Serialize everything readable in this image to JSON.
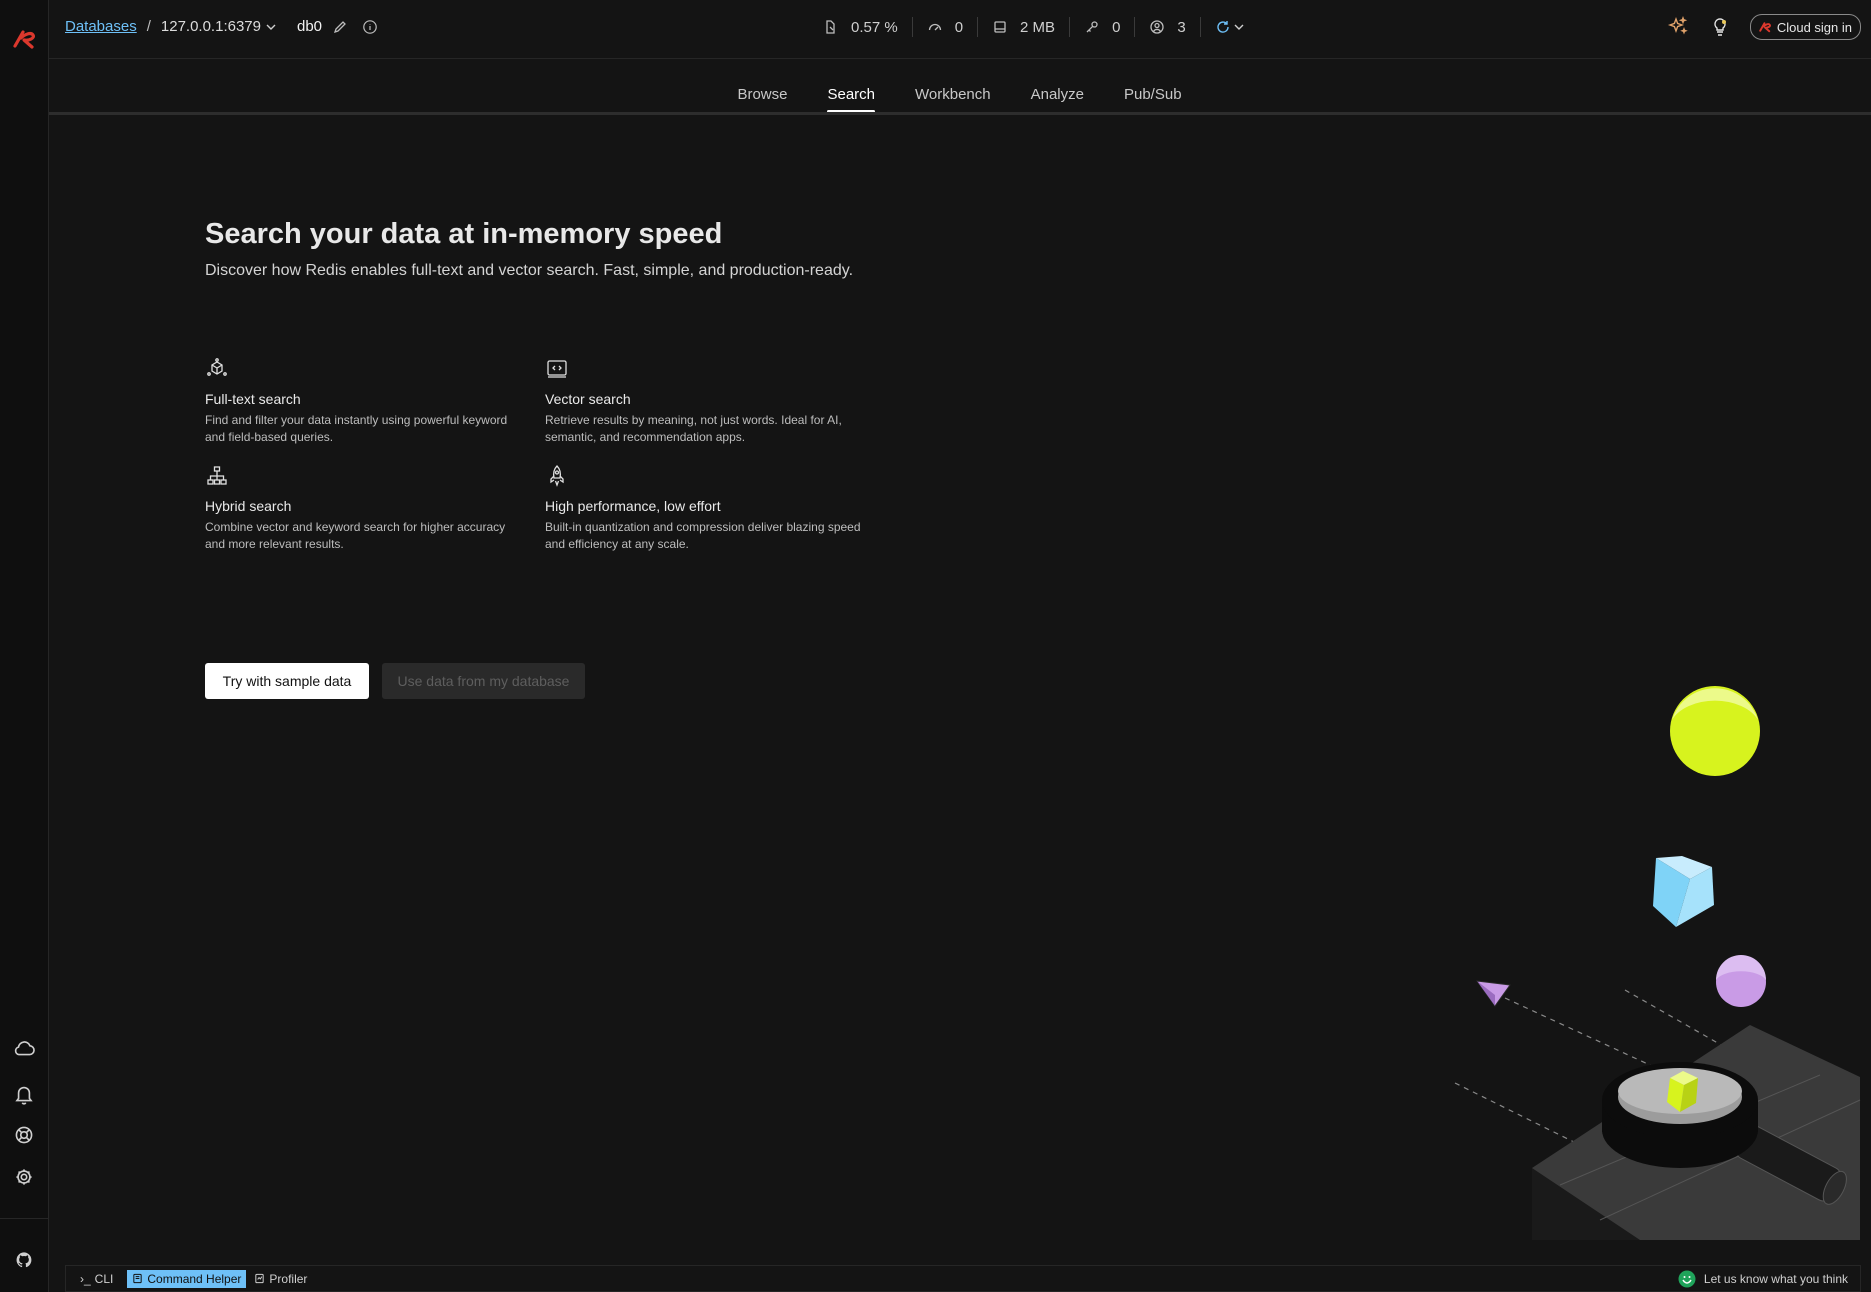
{
  "breadcrumb": {
    "databases": "Databases",
    "separator": "/",
    "host": "127.0.0.1:6379",
    "db": "db0"
  },
  "stats": {
    "cpu": "0.57 %",
    "ops": "0",
    "memory": "2 MB",
    "keys": "0",
    "clients": "3"
  },
  "header": {
    "cloud_signin": "Cloud sign in"
  },
  "tabs": [
    {
      "label": "Browse"
    },
    {
      "label": "Search"
    },
    {
      "label": "Workbench"
    },
    {
      "label": "Analyze"
    },
    {
      "label": "Pub/Sub"
    }
  ],
  "active_tab": "Search",
  "hero": {
    "title": "Search your data at in-memory speed",
    "subtitle": "Discover how Redis enables full-text and vector search. Fast, simple, and production-ready."
  },
  "features": [
    {
      "icon": "cube-network-icon",
      "title": "Full-text search",
      "desc": "Find and filter your data instantly using powerful keyword and field-based queries."
    },
    {
      "icon": "code-window-icon",
      "title": "Vector search",
      "desc": "Retrieve results by meaning, not just words. Ideal for AI, semantic, and recommendation apps."
    },
    {
      "icon": "hierarchy-icon",
      "title": "Hybrid search",
      "desc": "Combine vector and keyword search for higher accuracy and more relevant results."
    },
    {
      "icon": "rocket-icon",
      "title": "High performance, low effort",
      "desc": "Built-in quantization and compression deliver blazing speed and efficiency at any scale."
    }
  ],
  "actions": {
    "try_sample": "Try with sample data",
    "use_my_data": "Use data from my database"
  },
  "bottom_bar": {
    "cli": "CLI",
    "command_helper": "Command Helper",
    "profiler": "Profiler",
    "feedback": "Let us know what you think"
  },
  "colors": {
    "accent": "#6ec0f7",
    "brand_red": "#dc382d",
    "background": "#141414",
    "lime": "#d7f31e",
    "sky": "#7fd3f7",
    "lilac": "#c99be6"
  }
}
